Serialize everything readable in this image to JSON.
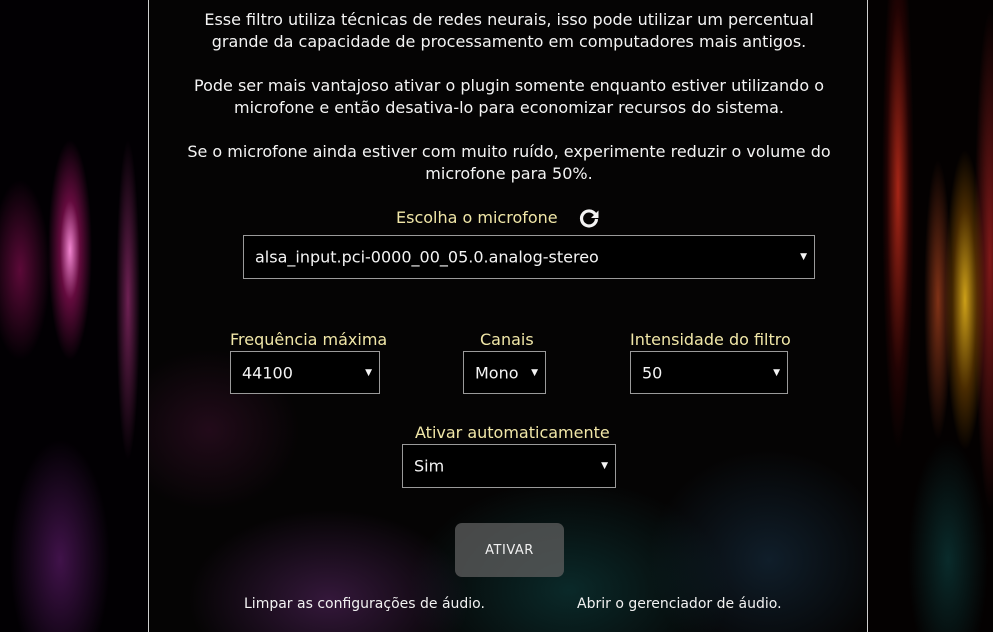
{
  "info": {
    "paragraph1": [
      "Esse filtro utiliza técnicas de redes neurais, isso pode utilizar um percentual",
      "grande da capacidade de processamento em computadores mais antigos."
    ],
    "paragraph2": [
      "Pode ser mais vantajoso ativar o plugin somente enquanto estiver utilizando o",
      "microfone e então desativa-lo para economizar recursos do sistema."
    ],
    "paragraph3": [
      "Se o microfone ainda estiver com muito ruído, experimente reduzir o volume do",
      "microfone para 50%."
    ]
  },
  "microphone": {
    "label": "Escolha o microfone",
    "refresh_icon": "refresh-icon",
    "selected": "alsa_input.pci-0000_00_05.0.analog-stereo"
  },
  "settings": {
    "max_frequency": {
      "label": "Frequência máxima",
      "selected": "44100"
    },
    "channels": {
      "label": "Canais",
      "selected": "Mono"
    },
    "filter_intensity": {
      "label": "Intensidade do filtro",
      "selected": "50"
    },
    "auto_activate": {
      "label": "Ativar automaticamente",
      "selected": "Sim"
    }
  },
  "actions": {
    "activate_label": "ATIVAR",
    "clear_audio_settings": "Limpar as configurações de áudio.",
    "open_audio_manager": "Abrir o gerenciador de áudio."
  },
  "colors": {
    "label_accent": "#f1e7a8",
    "background": "#050404",
    "button_bg": "#5f5f5f"
  }
}
